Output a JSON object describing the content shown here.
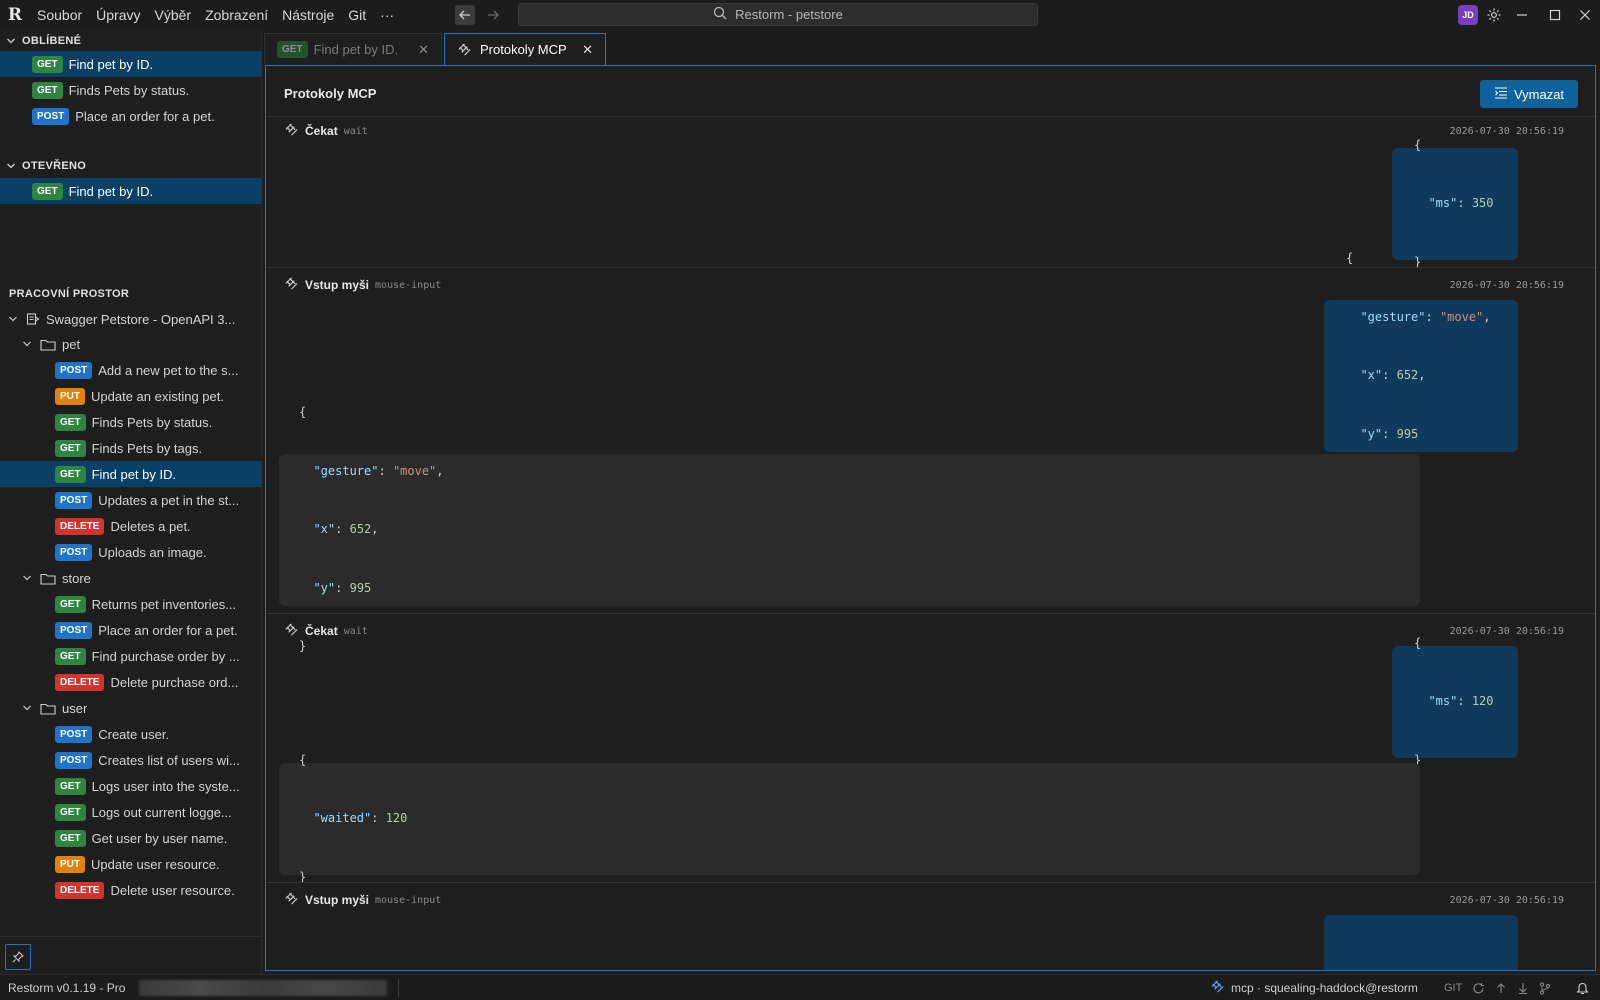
{
  "titlebar": {
    "logo": "R",
    "menu": [
      "Soubor",
      "Úpravy",
      "Výběr",
      "Zobrazení",
      "Nástroje",
      "Git",
      "···"
    ],
    "search_text": "Restorm - petstore",
    "avatar_initials": "JD"
  },
  "sidebar": {
    "favorites": {
      "title": "OBLÍBENÉ",
      "items": [
        {
          "method": "GET",
          "label": "Find pet by ID.",
          "selected": true
        },
        {
          "method": "GET",
          "label": "Finds Pets by status."
        },
        {
          "method": "POST",
          "label": "Place an order for a pet."
        }
      ]
    },
    "open": {
      "title": "OTEVŘENO",
      "items": [
        {
          "method": "GET",
          "label": "Find pet by ID.",
          "selected": true
        }
      ]
    },
    "workspace": {
      "title": "PRACOVNÍ PROSTOR",
      "collection": "Swagger Petstore - OpenAPI 3...",
      "folders": [
        {
          "name": "pet",
          "items": [
            {
              "method": "POST",
              "label": "Add a new pet to the s..."
            },
            {
              "method": "PUT",
              "label": "Update an existing pet."
            },
            {
              "method": "GET",
              "label": "Finds Pets by status."
            },
            {
              "method": "GET",
              "label": "Finds Pets by tags."
            },
            {
              "method": "GET",
              "label": "Find pet by ID.",
              "selected": true
            },
            {
              "method": "POST",
              "label": "Updates a pet in the st..."
            },
            {
              "method": "DELETE",
              "label": "Deletes a pet."
            },
            {
              "method": "POST",
              "label": "Uploads an image."
            }
          ]
        },
        {
          "name": "store",
          "items": [
            {
              "method": "GET",
              "label": "Returns pet inventories..."
            },
            {
              "method": "POST",
              "label": "Place an order for a pet."
            },
            {
              "method": "GET",
              "label": "Find purchase order by ..."
            },
            {
              "method": "DELETE",
              "label": "Delete purchase ord..."
            }
          ]
        },
        {
          "name": "user",
          "items": [
            {
              "method": "POST",
              "label": "Create user."
            },
            {
              "method": "POST",
              "label": "Creates list of users wi..."
            },
            {
              "method": "GET",
              "label": "Logs user into the syste..."
            },
            {
              "method": "GET",
              "label": "Logs out current logge..."
            },
            {
              "method": "GET",
              "label": "Get user by user name."
            },
            {
              "method": "PUT",
              "label": "Update user resource."
            },
            {
              "method": "DELETE",
              "label": "Delete user resource."
            }
          ]
        }
      ]
    }
  },
  "tabs": [
    {
      "method": "GET",
      "label": "Find pet by ID.",
      "active": false
    },
    {
      "label": "Protokoly MCP",
      "active": true
    }
  ],
  "panel": {
    "title": "Protokoly MCP",
    "clear_label": "Vymazat",
    "entries": [
      {
        "title": "Čekat",
        "code": "wait",
        "time": "2026-07-30 20:56:19",
        "request": [
          "{",
          "  \"ms\": 350",
          "}"
        ]
      },
      {
        "title": "Vstup myši",
        "code": "mouse-input",
        "time": "2026-07-30 20:56:19",
        "request": [
          "{",
          "  \"gesture\": \"move\",",
          "  \"x\": 652,",
          "  \"y\": 995",
          "}"
        ],
        "response": [
          "{",
          "  \"gesture\": \"move\",",
          "  \"x\": 652,",
          "  \"y\": 995",
          "}"
        ]
      },
      {
        "title": "Čekat",
        "code": "wait",
        "time": "2026-07-30 20:56:19",
        "request": [
          "{",
          "  \"ms\": 120",
          "}"
        ],
        "response": [
          "{",
          "  \"waited\": 120",
          "}"
        ]
      },
      {
        "title": "Vstup myši",
        "code": "mouse-input",
        "time": "2026-07-30 20:56:19"
      }
    ]
  },
  "statusbar": {
    "version": "Restorm v0.1.19 - Pro",
    "mcp": "mcp · squealing-haddock@restorm",
    "git": "GIT"
  },
  "colors": {
    "accent": "#1f74c8",
    "get": "#2e8540",
    "post": "#1f74c8",
    "put": "#e0820f",
    "delete": "#d1342f",
    "selection": "#0a3f66"
  }
}
